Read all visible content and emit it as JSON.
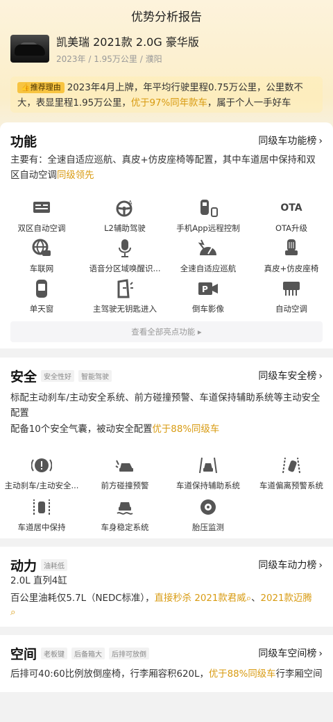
{
  "header": {
    "title": "优势分析报告"
  },
  "car": {
    "name": "凯美瑞 2021款 2.0G 豪华版",
    "meta": "2023年 / 1.95万公里 / 濮阳"
  },
  "reason": {
    "tag": "推荐理由",
    "text_a": "2023年4月上牌，年平均行驶里程0.75万公里，公里数不大，表显里程1.95万公里，",
    "highlight": "优于97%同年款车",
    "text_b": "，属于个人一手好车"
  },
  "function": {
    "title": "功能",
    "link": "同级车功能榜",
    "desc_a": "主要有：全速自适应巡航、真皮+仿皮座椅等配置，其中车道居中保持和双区自动空调",
    "desc_hl": "同级领先",
    "items": [
      {
        "label": "双区自动空调",
        "icon": "ac-panel-icon"
      },
      {
        "label": "L2辅助驾驶",
        "icon": "steering-wheel-icon"
      },
      {
        "label": "手机App远程控制",
        "icon": "phone-car-icon"
      },
      {
        "label": "OTA升级",
        "icon": "ota-icon"
      },
      {
        "label": "车联网",
        "icon": "globe-car-icon"
      },
      {
        "label": "语音分区域唤醒识...",
        "icon": "microphone-icon"
      },
      {
        "label": "全速自适应巡航",
        "icon": "cruise-gauge-icon"
      },
      {
        "label": "真皮+仿皮座椅",
        "icon": "seat-icon"
      },
      {
        "label": "单天窗",
        "icon": "sunroof-icon"
      },
      {
        "label": "主驾驶无钥匙进入",
        "icon": "door-key-icon"
      },
      {
        "label": "倒车影像",
        "icon": "parking-camera-icon"
      },
      {
        "label": "自动空调",
        "icon": "ac-vent-icon"
      }
    ],
    "see_all": "查看全部亮点功能 ▸",
    "ota_text": "OTA"
  },
  "safety": {
    "title": "安全",
    "tags": [
      "安全性好",
      "智能驾驶"
    ],
    "link": "同级车安全榜",
    "desc1": "标配主动刹车/主动安全系统、前方碰撞预警、车道保持辅助系统等主动安全配置",
    "desc2_a": "配备10个安全气囊，被动安全配置",
    "desc2_hl": "优于88%同级车",
    "items": [
      {
        "label": "主动刹车/主动安全...",
        "icon": "brake-warning-icon"
      },
      {
        "label": "前方碰撞预警",
        "icon": "collision-warning-icon"
      },
      {
        "label": "车道保持辅助系统",
        "icon": "lane-keep-icon"
      },
      {
        "label": "车道偏离预警系统",
        "icon": "lane-departure-icon"
      },
      {
        "label": "车道居中保持",
        "icon": "lane-center-icon"
      },
      {
        "label": "车身稳定系统",
        "icon": "stability-icon"
      },
      {
        "label": "胎压监测",
        "icon": "tire-pressure-icon"
      }
    ]
  },
  "power": {
    "title": "动力",
    "tags": [
      "油耗低"
    ],
    "link": "同级车动力榜",
    "engine": "2.0L 直列4缸",
    "fuel_a": "百公里油耗仅5.7L（NEDC标准），",
    "fuel_hl": "直接秒杀 2021款君威",
    "sep": "、",
    "fuel_hl2": "2021款迈腾"
  },
  "space": {
    "title": "空间",
    "tags": [
      "老板键",
      "后备箱大",
      "后排可放倒"
    ],
    "link": "同级车空间榜",
    "desc_a": "后排可40:60比例放倒座椅，行李厢容积620L，",
    "desc_hl": "优于88%同级车",
    "desc_b": "行李厢空间"
  },
  "colors": {
    "accent": "#d89b12",
    "tag_bg": "#f7c441",
    "hero_bg": "#fdf3dc"
  }
}
